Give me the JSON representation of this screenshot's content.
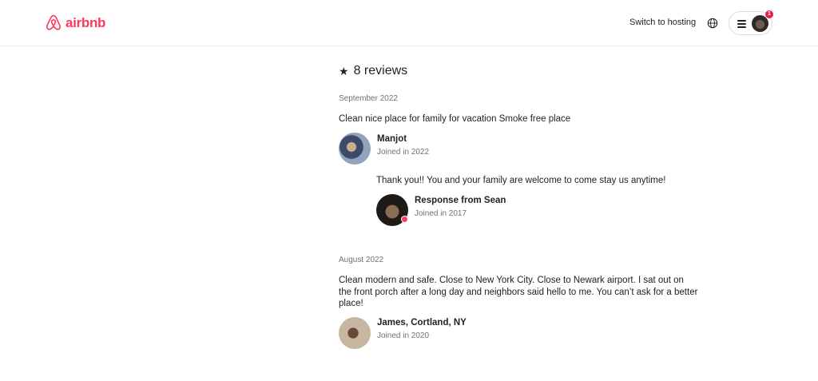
{
  "header": {
    "logo_text": "airbnb",
    "switch_to_hosting": "Switch to hosting",
    "notification_count": "1"
  },
  "reviews": {
    "title": "8 reviews",
    "items": [
      {
        "date": "September 2022",
        "text": "Clean nice place for family for vacation Smoke free place",
        "reviewer_name": "Manjot",
        "reviewer_joined": "Joined in 2022",
        "response": {
          "text": "Thank you!! You and your family are welcome to come stay us anytime!",
          "name": "Response from Sean",
          "joined": "Joined in 2017"
        }
      },
      {
        "date": "August 2022",
        "text": "Clean modern and safe. Close to New York City. Close to Newark airport. I sat out on the front porch after a long day and neighbors said hello to me. You can’t ask for a better place!",
        "reviewer_name": "James, Cortland, NY",
        "reviewer_joined": "Joined in 2020"
      }
    ]
  },
  "colors": {
    "brand": "#ff385c",
    "text_primary": "#222222",
    "text_secondary": "#717171"
  }
}
